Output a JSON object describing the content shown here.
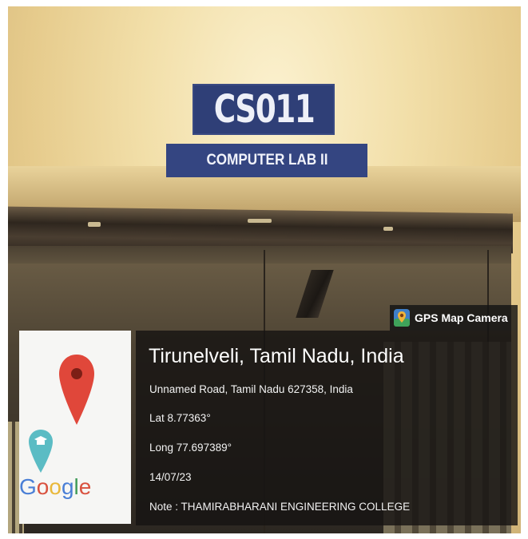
{
  "signs": {
    "room_code": "CS011",
    "room_name": "COMPUTER LAB II"
  },
  "gps_overlay": {
    "app_name": "GPS Map Camera",
    "location_title": "Tirunelveli, Tamil Nadu, India",
    "address": "Unnamed Road, Tamil Nadu 627358, India",
    "latitude": "Lat 8.77363°",
    "longitude": "Long 77.697389°",
    "date": "14/07/23",
    "note": "Note : THAMIRABHARANI ENGINEERING COLLEGE",
    "map_logo": "Google"
  },
  "colors": {
    "sign_blue": "#2f3f77",
    "pin_red": "#e0473a",
    "pin_teal": "#5bbcc4"
  }
}
